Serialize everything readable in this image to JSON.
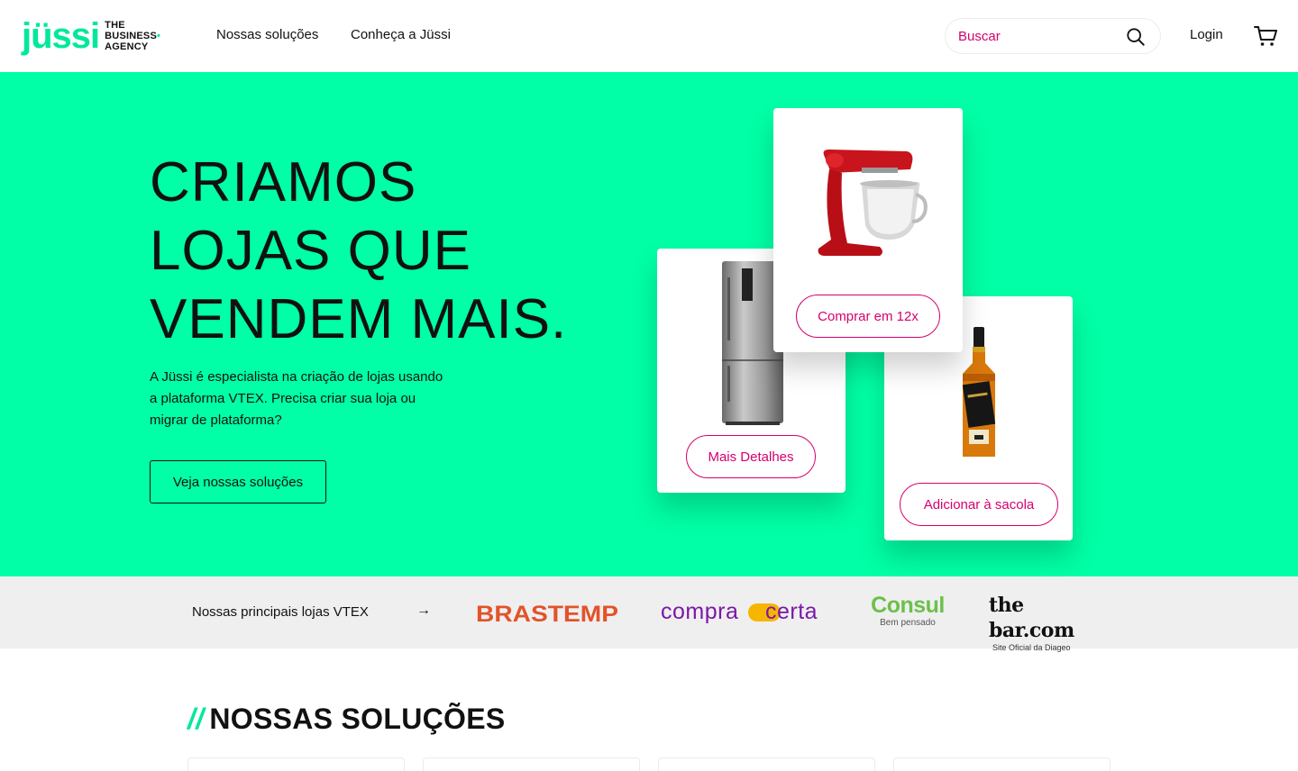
{
  "brand": {
    "logo_word": "jüssi",
    "logo_tag_line1": "THE",
    "logo_tag_line2": "BUSINESS",
    "logo_tag_line3": "AGENCY",
    "accent_color": "#00ffa6",
    "pink_color": "#d6006e"
  },
  "header": {
    "nav_items": [
      "Nossas soluções",
      "Conheça a Jüssi"
    ],
    "search_placeholder": "Buscar",
    "login_label": "Login",
    "cart_icon": "cart-icon",
    "search_icon": "search-icon"
  },
  "hero": {
    "title_line1": "CRIAMOS",
    "title_line2": "LOJAS QUE",
    "title_line3": "VENDEM MAIS.",
    "description": "A Jüssi é especialista na criação de lojas usando a plataforma VTEX. Precisa criar sua loja ou migrar de plataforma?",
    "cta_label": "Veja nossas soluções",
    "cards": {
      "mixer_button": "Comprar em 12x",
      "fridge_button": "Mais Detalhes",
      "bottle_button": "Adicionar à sacola"
    }
  },
  "brands_strip": {
    "label": "Nossas principais lojas VTEX",
    "arrow": "→",
    "logos": {
      "brastemp": "BRASTEMP",
      "compracerta_a": "compra",
      "compracerta_b": "certa",
      "consul": "Consul",
      "consul_tagline": "Bem pensado",
      "thebar": "the bar.com",
      "thebar_tagline": "Site Oficial da Diageo"
    }
  },
  "solutions": {
    "slashes": "//",
    "title": "NOSSAS SOLUÇÕES"
  }
}
